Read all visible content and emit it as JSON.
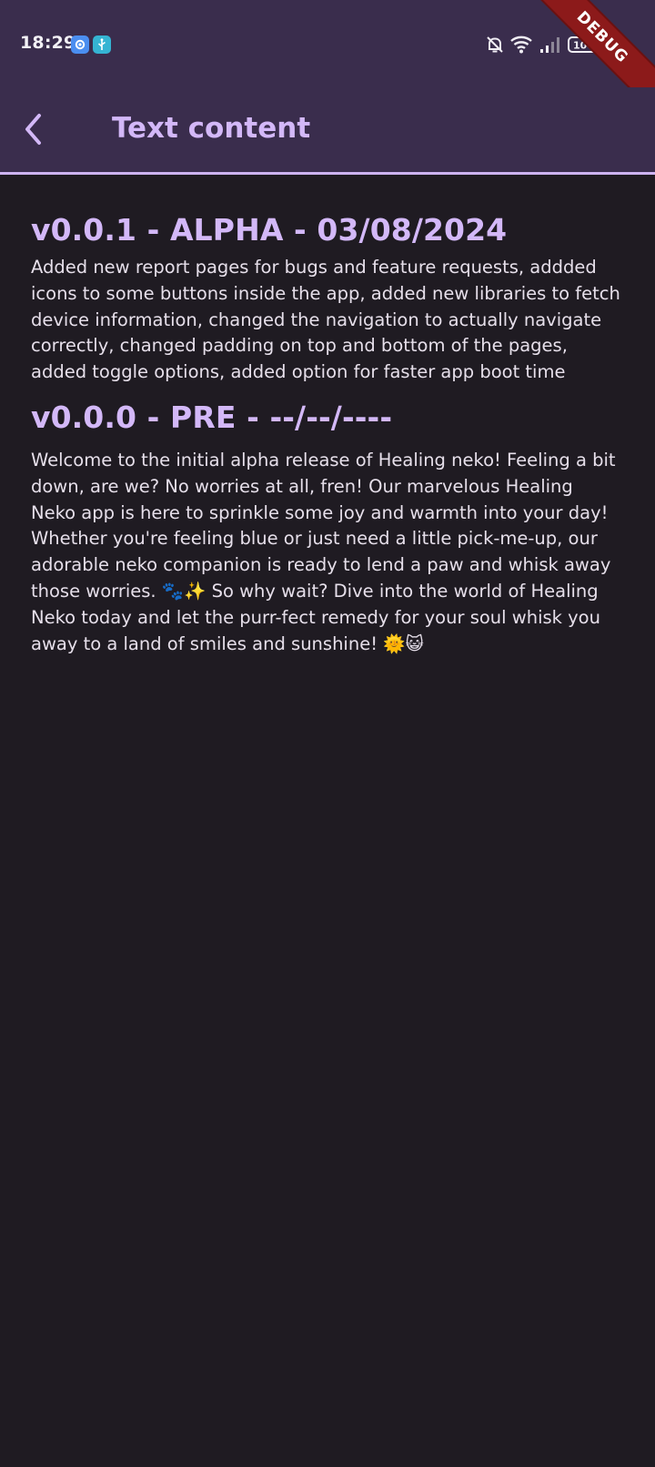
{
  "status_bar": {
    "time": "18:29",
    "left_icons": [
      "gear-icon",
      "usb-icon"
    ],
    "right_icons": [
      "bell-off-icon",
      "wifi-icon",
      "signal-icon",
      "battery-icon"
    ],
    "battery_level": "100",
    "debug_banner": "DEBUG"
  },
  "app_bar": {
    "back_icon": "chevron-left-icon",
    "title": "Text content"
  },
  "changelog": [
    {
      "heading": "v0.0.1 - ALPHA - 03/08/2024",
      "body": "Added new report pages for bugs and feature requests, addded icons to some buttons inside the app, added new libraries to fetch device information, changed the navigation to actually navigate correctly, changed padding on top and bottom of the pages, added toggle options, added option for faster app boot time"
    },
    {
      "heading": "v0.0.0 - PRE - --/--/----",
      "body": "Welcome to the initial alpha release of Healing neko! Feeling a bit down, are we? No worries at all, fren! Our marvelous Healing Neko app is here to sprinkle some joy and warmth into your day! Whether you're feeling blue or just need a little pick-me-up, our adorable neko companion is ready to lend a paw and whisk away those worries. 🐾✨ So why wait? Dive into the world of Healing Neko today and let the purr-fect remedy for your soul whisk you away to a land of smiles and sunshine! 🌞😺"
    }
  ],
  "colors": {
    "background": "#1f1b22",
    "app_bar": "#3a2d4d",
    "accent": "#d3b8f8",
    "text": "#e6dfea",
    "debug_ribbon": "#8c1a1a"
  }
}
